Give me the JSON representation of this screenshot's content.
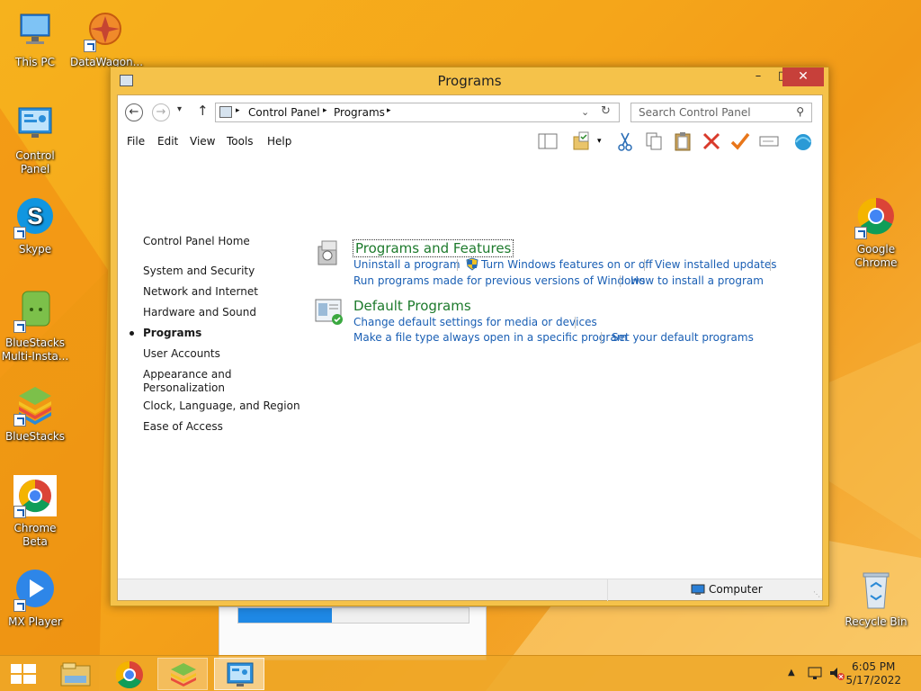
{
  "desktop": {
    "icons": [
      {
        "label": "This PC",
        "icon": "this-pc-icon"
      },
      {
        "label": "DataWagon...",
        "icon": "datawagon-icon"
      },
      {
        "label": "Control Panel",
        "icon": "control-panel-icon"
      },
      {
        "label": "Skype",
        "icon": "skype-icon"
      },
      {
        "label": "BlueStacks Multi-Insta...",
        "icon": "bluestacks-multi-icon"
      },
      {
        "label": "BlueStacks",
        "icon": "bluestacks-icon"
      },
      {
        "label": "Chrome Beta",
        "icon": "chrome-beta-icon"
      },
      {
        "label": "MX Player",
        "icon": "mx-player-icon"
      },
      {
        "label": "Google Chrome",
        "icon": "google-chrome-icon"
      },
      {
        "label": "Recycle Bin",
        "icon": "recycle-bin-icon"
      }
    ]
  },
  "window": {
    "title": "Programs",
    "controls": {
      "minimize": "–",
      "maximize": "□",
      "close": "✕"
    },
    "address": {
      "crumbs": [
        "Control Panel",
        "Programs"
      ],
      "search_placeholder": "Search Control Panel"
    },
    "menu": [
      "File",
      "Edit",
      "View",
      "Tools",
      "Help"
    ],
    "sidebar": {
      "home": "Control Panel Home",
      "items": [
        "System and Security",
        "Network and Internet",
        "Hardware and Sound",
        "Programs",
        "User Accounts",
        "Appearance and Personalization",
        "Clock, Language, and Region",
        "Ease of Access"
      ],
      "active_index": 3
    },
    "categories": [
      {
        "title": "Programs and Features",
        "links": [
          "Uninstall a program",
          "Turn Windows features on or off",
          "View installed updates",
          "Run programs made for previous versions of Windows",
          "How to install a program"
        ]
      },
      {
        "title": "Default Programs",
        "links": [
          "Change default settings for media or devices",
          "Make a file type always open in a specific program",
          "Set your default programs"
        ]
      }
    ],
    "status": {
      "location": "Computer"
    }
  },
  "taskbar": {
    "time": "6:05 PM",
    "date": "5/17/2022"
  },
  "colors": {
    "link": "#1a5fb4",
    "category_title": "#1d7a2c",
    "close_button": "#c7403a"
  }
}
